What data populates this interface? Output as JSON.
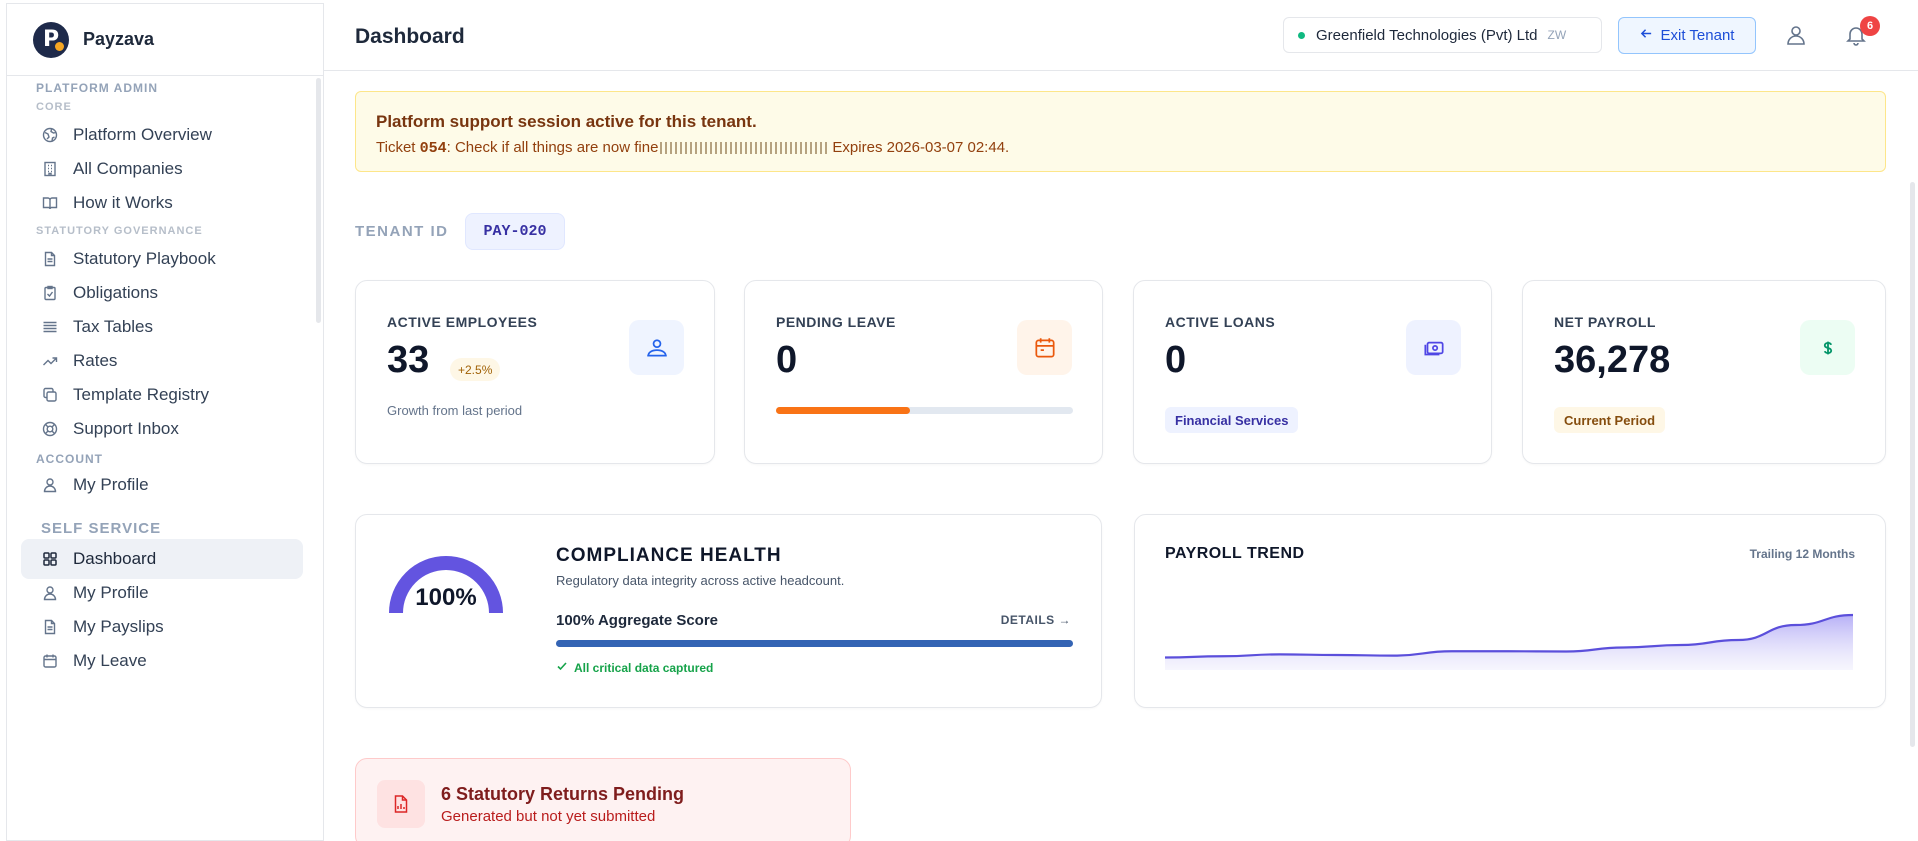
{
  "brand": {
    "name": "Payzava"
  },
  "sidebar": {
    "sections": {
      "platform_admin": "PLATFORM ADMIN",
      "core": "CORE",
      "statutory_governance": "STATUTORY GOVERNANCE",
      "account": "ACCOUNT",
      "self_service": "SELF SERVICE"
    },
    "items": [
      {
        "label": "Platform Overview",
        "icon": "globe-icon"
      },
      {
        "label": "All Companies",
        "icon": "building-icon"
      },
      {
        "label": "How it Works",
        "icon": "book-icon"
      },
      {
        "label": "Statutory Playbook",
        "icon": "document-icon"
      },
      {
        "label": "Obligations",
        "icon": "clipboard-check-icon"
      },
      {
        "label": "Tax Tables",
        "icon": "list-icon"
      },
      {
        "label": "Rates",
        "icon": "trend-icon"
      },
      {
        "label": "Template Registry",
        "icon": "copy-icon"
      },
      {
        "label": "Support Inbox",
        "icon": "lifebuoy-icon"
      },
      {
        "label": "My Profile",
        "icon": "user-icon"
      },
      {
        "label": "Dashboard",
        "icon": "grid-icon",
        "active": true
      },
      {
        "label": "My Profile",
        "icon": "user-icon"
      },
      {
        "label": "My Payslips",
        "icon": "document-icon"
      },
      {
        "label": "My Leave",
        "icon": "calendar-icon"
      }
    ]
  },
  "header": {
    "title": "Dashboard",
    "tenant_name": "Greenfield Technologies (Pvt) Ltd",
    "tenant_code": "ZW",
    "exit_label": "Exit Tenant",
    "notification_count": "6"
  },
  "banner": {
    "title": "Platform support session active for this tenant.",
    "ticket_prefix": "Ticket ",
    "ticket_id": "054",
    "ticket_text": ": Check if all things are now fine",
    "expires": "Expires 2026-03-07 02:44."
  },
  "tenant": {
    "label": "TENANT ID",
    "id": "PAY-020"
  },
  "kpis": {
    "employees": {
      "label": "ACTIVE EMPLOYEES",
      "value": "33",
      "growth": "+2.5%",
      "sub": "Growth from last period",
      "icon": "users-icon"
    },
    "leave": {
      "label": "PENDING LEAVE",
      "value": "0",
      "progress": 0.45,
      "icon": "calendar-icon"
    },
    "loans": {
      "label": "ACTIVE LOANS",
      "value": "0",
      "tag": "Financial Services",
      "icon": "cash-icon"
    },
    "payroll": {
      "label": "NET PAYROLL",
      "value": "36,278",
      "tag": "Current Period",
      "icon": "dollar-icon"
    }
  },
  "compliance": {
    "gauge_value": "100%",
    "gauge_fraction": 1.0,
    "title": "COMPLIANCE HEALTH",
    "subtitle": "Regulatory data integrity across active headcount.",
    "score_label": "100% Aggregate Score",
    "score_fraction": 1.0,
    "details_label": "DETAILS →",
    "status": "All critical data captured"
  },
  "trend": {
    "title": "PAYROLL TREND",
    "meta": "Trailing 12 Months"
  },
  "chart_data": {
    "type": "area",
    "title": "PAYROLL TREND",
    "values": [
      10,
      11,
      12.5,
      12,
      11.5,
      15,
      15,
      14.8,
      18,
      20,
      24,
      36,
      44
    ],
    "ylim": [
      0,
      60
    ]
  },
  "alert": {
    "title": "6 Statutory Returns Pending",
    "subtitle": "Generated but not yet submitted"
  },
  "colors": {
    "accent": "#1d4ed8",
    "trend_line": "#5b4fdb",
    "trend_fill": "#c7c2f5",
    "gauge": "#6354e0",
    "leave_bar": "#f97316",
    "compliance_bar": "#3464b4"
  }
}
